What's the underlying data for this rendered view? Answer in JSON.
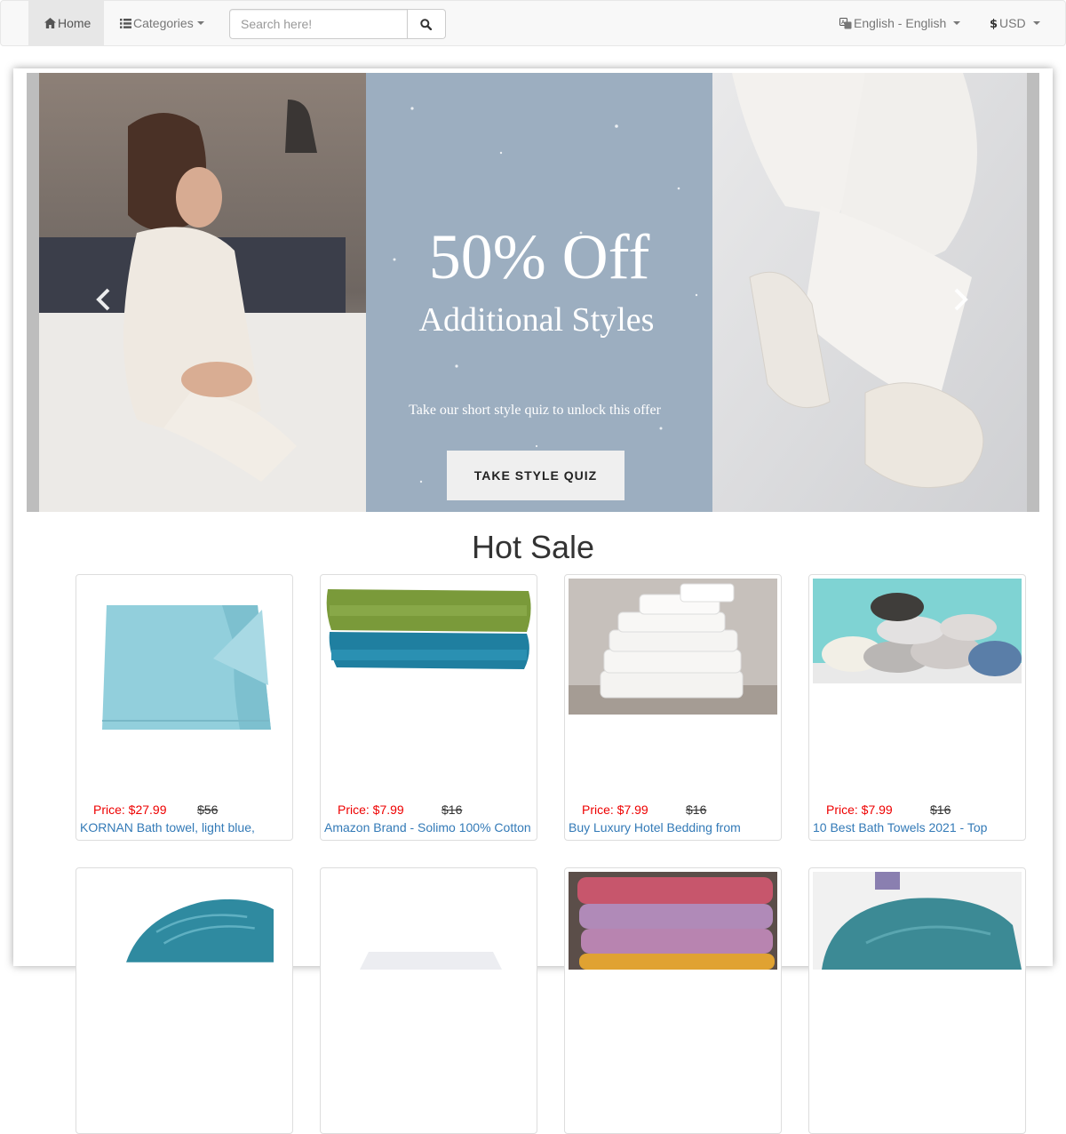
{
  "navbar": {
    "home_label": "Home",
    "categories_label": "Categories",
    "search_placeholder": "Search here!",
    "language_label": "English - English",
    "currency_label": "USD"
  },
  "banner": {
    "headline": "50% Off",
    "subheadline": "Additional Styles",
    "tagline": "Take our short style quiz to unlock this offer",
    "cta_label": "TAKE STYLE QUIZ"
  },
  "hot_sale": {
    "title": "Hot Sale",
    "products": [
      {
        "price": "Price: $27.99",
        "old_price": "$56",
        "title": "KORNAN Bath towel, light blue,"
      },
      {
        "price": "Price: $7.99",
        "old_price": "$16",
        "title": "Amazon Brand - Solimo 100% Cotton"
      },
      {
        "price": "Price: $7.99",
        "old_price": "$16",
        "title": "Buy Luxury Hotel Bedding from"
      },
      {
        "price": "Price: $7.99",
        "old_price": "$16",
        "title": "10 Best Bath Towels 2021 - Top"
      }
    ]
  },
  "colors": {
    "price_red": "#e00000",
    "link_blue": "#337ab7",
    "banner_blue": "#9caec0"
  }
}
